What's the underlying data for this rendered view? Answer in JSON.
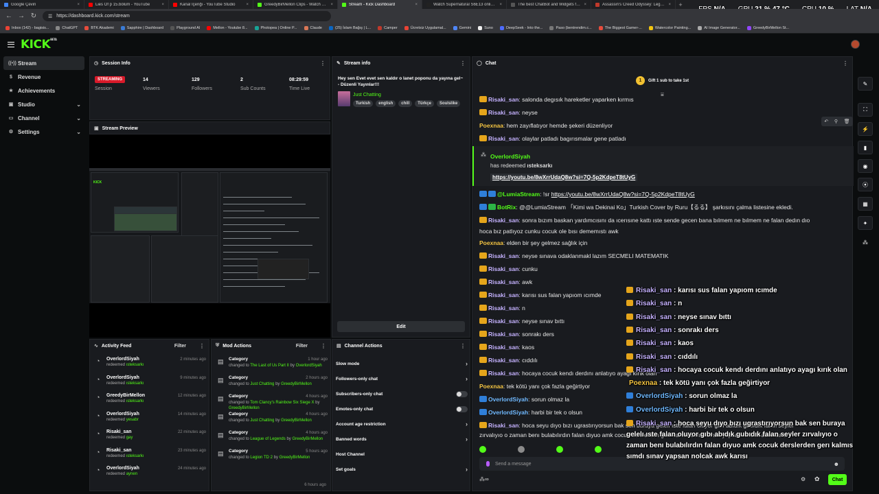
{
  "browser": {
    "tabs": [
      {
        "title": "Google Çeviri",
        "color": "#4285f4"
      },
      {
        "title": "Lies Of p 15.bölüm - YouTube",
        "color": "#ff0000"
      },
      {
        "title": "Kanal İçeriği - YouTube Studio",
        "color": "#ff0000"
      },
      {
        "title": "GreedyBirMellon Clips - Watch Li...",
        "color": "#53fc18"
      },
      {
        "title": "Stream - Kick Dashboard",
        "color": "#53fc18",
        "active": true
      },
      {
        "title": "Watch Supernatural S6E13 online...",
        "color": "#222222"
      },
      {
        "title": "The best ChatBot and Widgets fo...",
        "color": "#555555"
      },
      {
        "title": "Assassin's Creed Odyssey: Legen...",
        "color": "#c0392b"
      }
    ],
    "url": "https://dashboard.kick.com/stream",
    "bookmarks": [
      {
        "label": "Inbox (142) - bagisis...",
        "color": "#ea4335"
      },
      {
        "label": "ChatGPT",
        "color": "#888888"
      },
      {
        "label": "BTK Akademi",
        "color": "#e74c3c"
      },
      {
        "label": "Sapphire | Dashboard",
        "color": "#3a7bd5"
      },
      {
        "label": "Playground AI",
        "color": "#555555"
      },
      {
        "label": "Mellon - Youtube 8...",
        "color": "#ff0000"
      },
      {
        "label": "Photopea | Online P...",
        "color": "#18a497"
      },
      {
        "label": "Claude",
        "color": "#d97757"
      },
      {
        "label": "(25) İslam Bağış | L...",
        "color": "#0a66c2"
      },
      {
        "label": "Camper",
        "color": "#c0392b"
      },
      {
        "label": "Ücretsiz Uygulamal...",
        "color": "#ea4335"
      },
      {
        "label": "Gemini",
        "color": "#4f86f7"
      },
      {
        "label": "Suno",
        "color": "#eeeeee"
      },
      {
        "label": "DeepSeek - Into the...",
        "color": "#4d6bfe"
      },
      {
        "label": "Paso (bentrendim.c...",
        "color": "#777777"
      },
      {
        "label": "The Biggest Gamer-...",
        "color": "#e74c3c"
      },
      {
        "label": "Watercolor Painting...",
        "color": "#f1c40f"
      },
      {
        "label": "AI Image Generator...",
        "color": "#aaaaaa"
      },
      {
        "label": "GreedyBirMellon St...",
        "color": "#9146ff"
      }
    ],
    "perf": {
      "fps_label": "FPS",
      "fps": "N/A",
      "gpu_label": "GPU",
      "gpu": "21 % 47 °C",
      "cpu_label": "CPU",
      "cpu": "10 %",
      "lat_label": "LAT",
      "lat": "N/A"
    }
  },
  "app": {
    "logo": "KICK",
    "logo_sup": "BETA",
    "sidebar": [
      {
        "label": "Stream",
        "icon": "broadcast-icon",
        "glyph": "((•))",
        "active": true
      },
      {
        "label": "Revenue",
        "icon": "dollar-icon",
        "glyph": "$"
      },
      {
        "label": "Achievements",
        "icon": "trophy-icon",
        "glyph": "★"
      },
      {
        "label": "Studio",
        "icon": "film-icon",
        "glyph": "▣",
        "expand": true
      },
      {
        "label": "Channel",
        "icon": "tv-icon",
        "glyph": "▭",
        "expand": true
      },
      {
        "label": "Settings",
        "icon": "gear-icon",
        "glyph": "⚙",
        "expand": true
      }
    ]
  },
  "session": {
    "title": "Session Info",
    "badge": "STREAMING",
    "badge_label": "Session",
    "viewers": "14",
    "viewers_label": "Viewers",
    "followers": "129",
    "followers_label": "Followers",
    "subs": "2",
    "subs_label": "Sub Counts",
    "time": "08:29:59",
    "time_label": "Time Live"
  },
  "preview": {
    "title": "Stream Preview"
  },
  "stream_info": {
    "title": "Stream info",
    "stream_title": "Hey sen Evet evet sen kaldır o lanet poponu da yayına gel~ - Düzenli Yayınlar!!!",
    "category": "Just Chatting",
    "tags": [
      "Turkish",
      "english",
      "chill",
      "Türkçe",
      "Soulslike"
    ],
    "edit": "Edit"
  },
  "activity": {
    "title": "Activity Feed",
    "filter": "Filter",
    "items": [
      {
        "user": "OverlordSiyah",
        "action": "redeemed",
        "item": "ısteksarkı",
        "time": "2 minutes ago"
      },
      {
        "user": "OverlordSiyah",
        "action": "redeemed",
        "item": "ısteksarkı",
        "time": "9 minutes ago"
      },
      {
        "user": "GreedyBirMellon",
        "action": "redeemed",
        "item": "ısteksarkı",
        "time": "12 minutes ago"
      },
      {
        "user": "OverlordSiyah",
        "action": "redeemed",
        "item": "yesabr",
        "time": "14 minutes ago"
      },
      {
        "user": "Risaki_san",
        "action": "redeemed",
        "item": "gay",
        "time": "22 minutes ago"
      },
      {
        "user": "Risaki_san",
        "action": "redeemed",
        "item": "ısteksarkı",
        "time": "23 minutes ago"
      },
      {
        "user": "OverlordSiyah",
        "action": "redeemed",
        "item": "aynen",
        "time": "24 minutes ago"
      }
    ]
  },
  "mod": {
    "title": "Mod Actions",
    "filter": "Filter",
    "items": [
      {
        "label": "Category",
        "pre": "changed to",
        "cat": "The Last of Us Part II",
        "by": "by",
        "user": "OverlordSiyah",
        "time": "1 hour ago"
      },
      {
        "label": "Category",
        "pre": "changed to",
        "cat": "Just Chatting",
        "by": "by",
        "user": "GreedyBirMellon",
        "time": "2 hours ago"
      },
      {
        "label": "Category",
        "pre": "changed to",
        "cat": "Tom Clancy's Rainbow Six Siege X",
        "by": "by",
        "user": "GreedyBirMellon",
        "time": "4 hours ago"
      },
      {
        "label": "Category",
        "pre": "changed to",
        "cat": "Just Chatting",
        "by": "by",
        "user": "GreedyBirMellon",
        "time": "4 hours ago"
      },
      {
        "label": "Category",
        "pre": "changed to",
        "cat": "League of Legends",
        "by": "by",
        "user": "GreedyBirMellon",
        "time": "4 hours ago"
      },
      {
        "label": "Category",
        "pre": "changed to",
        "cat": "Legion TD 2",
        "by": "by",
        "user": "GreedyBirMellon",
        "time": "5 hours ago"
      }
    ],
    "cut_time": "6 hours ago"
  },
  "channel_actions": {
    "title": "Channel Actions",
    "items": [
      {
        "label": "Slow mode",
        "kind": "arrow"
      },
      {
        "label": "Followers-only chat",
        "kind": "arrow"
      },
      {
        "label": "Subscribers-only chat",
        "kind": "toggle"
      },
      {
        "label": "Emotes-only chat",
        "kind": "toggle"
      },
      {
        "label": "Account age restriction",
        "kind": "arrow"
      },
      {
        "label": "Banned words",
        "kind": "arrow"
      },
      {
        "label": "Host Channel",
        "kind": "none"
      },
      {
        "label": "Set goals",
        "kind": "arrow"
      }
    ]
  },
  "chat": {
    "title": "Chat",
    "gift_count": "1",
    "gift_text": "Gift 1 sub to take 1st",
    "redeem_user": "OverlordSiyah",
    "redeem_text": "has redeemed",
    "redeem_item": "ısteksarkı",
    "redeem_link": "https://youtu.be/8wXrrUdaQ8w?si=7Q-5p2KdpeT8tUyG",
    "placeholder": "Send a message",
    "send": "Chat",
    "messages_top": [
      {
        "badge": "gold",
        "user": "Risaki_san",
        "cls": "pink",
        "text": "salonda degısık hareketler yaparken kırmıs"
      },
      {
        "badge": "gold",
        "user": "Risaki_san",
        "cls": "pink",
        "text": "neyse"
      },
      {
        "badge": "",
        "user": "Poexnaa",
        "cls": "orange",
        "text": "hem zayıflatıyor hemde şekeri düzenliyor"
      },
      {
        "badge": "gold",
        "user": "Risaki_san",
        "cls": "pink",
        "text": "olaylar patladı bagırısmalar gene patladı"
      }
    ],
    "lumia_user": "@LumiaStream",
    "lumia_text": "!sr",
    "lumia_link": "https://youtu.be/8wXrrUdaQ8w?si=7Q-5p2KdpeT8tUyG",
    "botrix_user": "BotRix",
    "botrix_text": "@@LumiaStream 「Kimi wa Dekinai Ko」Turkish Cover by Ruru【るる】 şarkısını çalma listesine ekledi.",
    "long_user": "Risaki_san",
    "long_text_1": "sonra bızım baskan yardımcısını da ıcerısıne kattı ıste sende gecen bana bılmem ne bılmem ne falan dedın dıo",
    "long_text_2": "hoca bız patlıyoz cunku cocuk ole bısı dememıstı awk",
    "messages_bottom": [
      {
        "badge": "",
        "user": "Poexnaa",
        "cls": "orange",
        "text": "elden bir şey gelmez sağlık için"
      },
      {
        "badge": "gold",
        "user": "Risaki_san",
        "cls": "pink",
        "text": "neyse sınava odaklanmakl lazım SECMELI MATEMATIK"
      },
      {
        "badge": "gold",
        "user": "Risaki_san",
        "cls": "pink",
        "text": "cunku"
      },
      {
        "badge": "gold",
        "user": "Risaki_san",
        "cls": "pink",
        "text": "awk"
      },
      {
        "badge": "gold",
        "user": "Risaki_san",
        "cls": "pink",
        "text": "karısı sus falan yapıom ıcımde"
      },
      {
        "badge": "gold",
        "user": "Risaki_san",
        "cls": "pink",
        "text": "n"
      },
      {
        "badge": "gold",
        "user": "Risaki_san",
        "cls": "pink",
        "text": "neyse sınav bıttı"
      },
      {
        "badge": "gold",
        "user": "Risaki_san",
        "cls": "pink",
        "text": "sonrakı ders"
      },
      {
        "badge": "gold",
        "user": "Risaki_san",
        "cls": "pink",
        "text": "kaos"
      },
      {
        "badge": "gold",
        "user": "Risaki_san",
        "cls": "pink",
        "text": "cıddılı"
      },
      {
        "badge": "gold",
        "user": "Risaki_san",
        "cls": "pink",
        "text": "hocaya cocuk kendı derdını anlatıyo ayagı kırık olan"
      },
      {
        "badge": "",
        "user": "Poexnaa",
        "cls": "orange",
        "text": "tek kötü yanı çok fazla geğirtiyor"
      },
      {
        "badge": "blue",
        "user": "OverlordSiyah",
        "cls": "cyan",
        "text": "sorun olmaz la"
      },
      {
        "badge": "blue",
        "user": "OverlordSiyah",
        "cls": "cyan",
        "text": "harbi bir tek o olsun"
      }
    ],
    "last_user": "Risaki_san",
    "last_text_1": "hoca seyu dıyo bızı ugrastırıyorsun bak sen buraya gelelı ıste falan oluyor gıbı abıdık gubıdık falan seyler",
    "last_text_2": "zırvalıyıo o zaman benı bulabılırdın falan dıyuo amk cocuk derslerden gerı kalmıs sımdı sınav yapsan nolcak awk karısı"
  },
  "overlay": {
    "messages": [
      {
        "badge": "gold",
        "user": "Risaki_san",
        "text": "karısı sus falan yapıom ıcımde"
      },
      {
        "badge": "gold",
        "user": "Risaki_san",
        "text": "n"
      },
      {
        "badge": "gold",
        "user": "Risaki_san",
        "text": "neyse sınav bıttı"
      },
      {
        "badge": "gold",
        "user": "Risaki_san",
        "text": "sonrakı ders"
      },
      {
        "badge": "gold",
        "user": "Risaki_san",
        "text": "kaos"
      },
      {
        "badge": "gold",
        "user": "Risaki_san",
        "text": "cıddılı"
      },
      {
        "badge": "gold",
        "user": "Risaki_san",
        "text": "hocaya cocuk kendı derdını anlatıyo ayagı kırık olan"
      },
      {
        "badge": "",
        "user": "Poexnaa",
        "text": "tek kötü yanı çok fazla geğirtiyor"
      },
      {
        "badge": "blue",
        "user": "OverlordSiyah",
        "text": "sorun olmaz la"
      },
      {
        "badge": "blue",
        "user": "OverlordSiyah",
        "text": "harbi bir tek o olsun"
      }
    ],
    "last_user": "Risaki_san",
    "last_lines": [
      "hoca seyu dıyo bızı ugrastırıyorsun bak sen buraya",
      "gelelı ıste falan oluyor gıbı abıdık gubıdık falan seyler zırvalıyıo o",
      "zaman benı bulabılırdın falan dıyuo amk cocuk derslerden gerı kalmıs",
      "sımdı sınav yapsan nolcak awk karısı"
    ]
  }
}
